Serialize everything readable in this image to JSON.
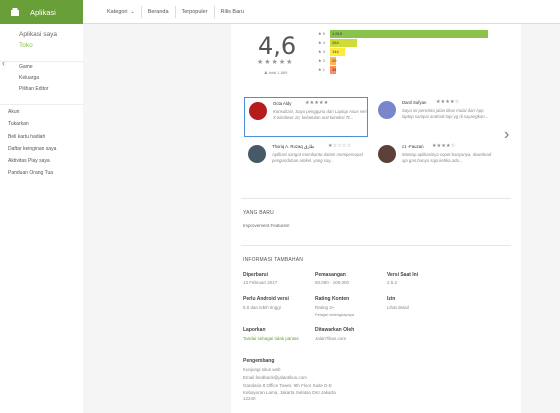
{
  "header": {
    "brand": "Aplikasi",
    "nav": {
      "category": "Kategori",
      "home": "Beranda",
      "top": "Terpopuler",
      "new": "Rilis Baru"
    }
  },
  "sidebar": {
    "main": [
      "Aplikasi saya",
      "Toko"
    ],
    "sub": [
      "Game",
      "Keluarga",
      "Pilihan Editor"
    ],
    "links": [
      "Akun",
      "Tukarkan",
      "Beli kartu hadiah",
      "Daftar keinginan saya",
      "Aktivitas Play saya",
      "Panduan Orang Tua"
    ]
  },
  "rating": {
    "average": "4,6",
    "total": "total 1.889",
    "bars": [
      {
        "label": "5",
        "count": "1.519",
        "value": 1519,
        "color": "#8bc34a"
      },
      {
        "label": "4",
        "count": "264",
        "value": 264,
        "color": "#cddc39"
      },
      {
        "label": "3",
        "count": "144",
        "value": 144,
        "color": "#ffeb3b"
      },
      {
        "label": "2",
        "count": "29",
        "value": 29,
        "color": "#ffb74d"
      },
      {
        "label": "1",
        "count": "34",
        "value": 34,
        "color": "#ff8a65"
      }
    ]
  },
  "reviews": [
    {
      "name": "Octa Aldy",
      "stars": 5,
      "text": "Konsultasi, Saya pengguna dari Laptop Asus seri X windows 10, kebetulan unit koneksi Tc...",
      "avatar_color": "#b71c1c"
    },
    {
      "name": "Danil Sufyan",
      "stars": 4,
      "text": "Saya ini pencinta jalan tikus mulai dari App laptop sampai android tapi yg di sayangkan...",
      "avatar_color": "#7986cb"
    },
    {
      "name": "Thoriq A. Rozaq  طارق",
      "stars": 1,
      "text": "Aplikasi sangat membantu dalam mempercepat pengunduhan artikel. yang say...",
      "avatar_color": "#455a64"
    },
    {
      "name": "c1 -Fauzan",
      "stars": 4,
      "text": "Mantap aplikasinya cepet banyanya, download aja gan,hanya saja ketika ada...",
      "avatar_color": "#5d4037"
    }
  ],
  "whats_new": {
    "title": "YANG BARU",
    "text": "Improvement Features!"
  },
  "additional_info": {
    "title": "INFORMASI TAMBAHAN",
    "updated": {
      "label": "Diperbarui",
      "value": "13 Februari 2017"
    },
    "installs": {
      "label": "Pemasangan",
      "value": "50.000 - 100.000"
    },
    "version": {
      "label": "Versi Saat Ini",
      "value": "2.5.2"
    },
    "android": {
      "label": "Perlu Android versi",
      "value": "5.0 dan lebih tinggi"
    },
    "content_rating": {
      "label": "Rating Konten",
      "value": "Rating 3+",
      "extra": "Pelajari selengkapnya"
    },
    "permissions": {
      "label": "Izin",
      "value": "Lihat detail"
    },
    "report": {
      "label": "Laporkan",
      "value": "Tandai sebagai tidak pantas"
    },
    "offered_by": {
      "label": "Ditawarkan Oleh",
      "value": "JalanTikus.com"
    },
    "developer": {
      "label": "Pengembang",
      "website": "Kunjungi situs web",
      "email": "Email feedback@jalantikus.com",
      "address": "Gandaria 8 Office Tower, 9th Floor Suite D-E Kebayoran Lama, Jakarta Selatan DKI Jakarta 12240"
    }
  }
}
